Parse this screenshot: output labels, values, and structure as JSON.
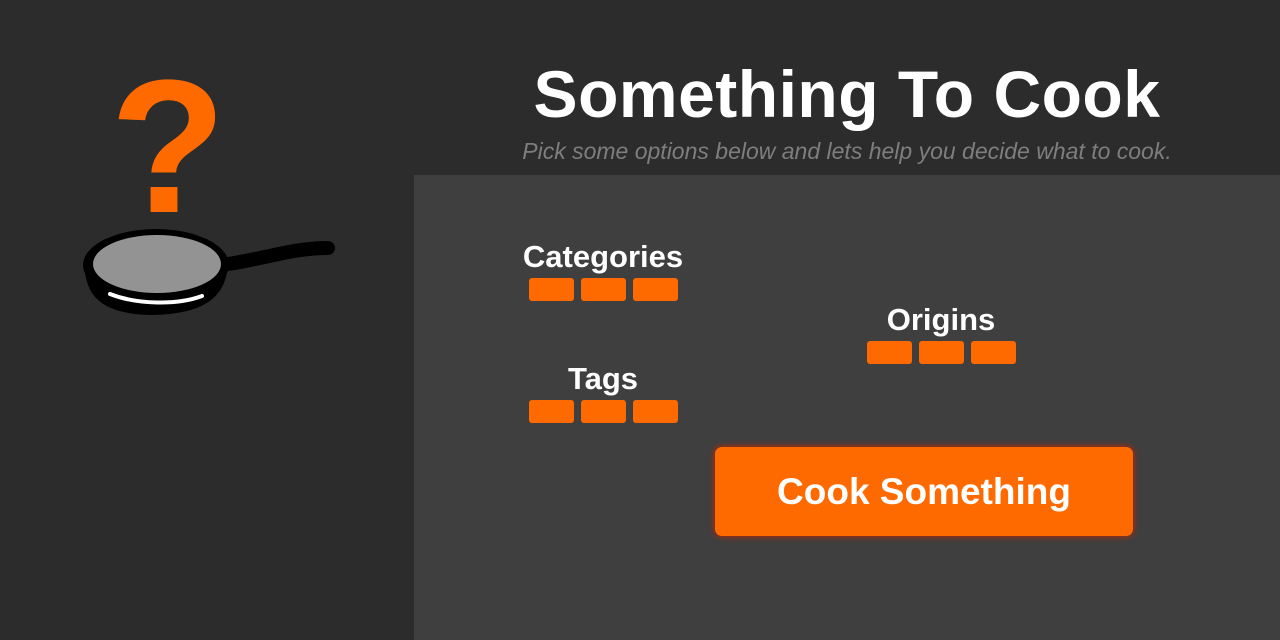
{
  "header": {
    "title": "Something To Cook",
    "subtitle": "Pick some options below and lets help you decide what to cook."
  },
  "logo": {
    "question_mark": "?",
    "icon": "frying-pan-icon"
  },
  "filters": {
    "categories": {
      "label": "Categories",
      "chip_count": 3
    },
    "tags": {
      "label": "Tags",
      "chip_count": 3
    },
    "origins": {
      "label": "Origins",
      "chip_count": 3
    }
  },
  "actions": {
    "cook_label": "Cook Something"
  },
  "colors": {
    "accent": "#ff6a00",
    "background": "#2c2c2c",
    "panel": "#3f3f3f",
    "subtitle": "#7e7e7e",
    "text": "#ffffff"
  }
}
